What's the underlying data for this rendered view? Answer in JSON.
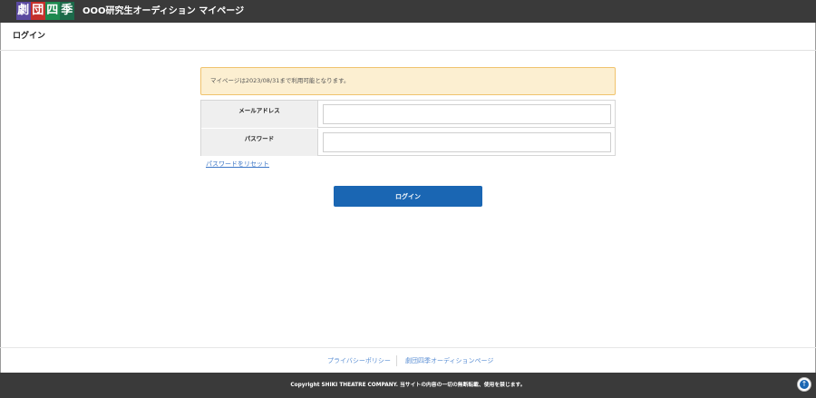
{
  "header": {
    "logo_chars": [
      "劇",
      "団",
      "四",
      "季"
    ],
    "site_title": "OOO研究生オーディション マイページ"
  },
  "page": {
    "title": "ログイン"
  },
  "notice": {
    "text": "マイページは2023/08/31まで利用可能となります。"
  },
  "form": {
    "email_label": "メールアドレス",
    "email_value": "",
    "password_label": "パスワード",
    "password_value": "",
    "reset_link": "パスワードをリセット",
    "submit_label": "ログイン"
  },
  "footer": {
    "links": [
      "プライバシーポリシー",
      "劇団四季オーディションページ"
    ],
    "copyright": "Copyright SHIKI THEATRE COMPANY. 当サイトの内容の一切の無断転載、使用を禁じます。"
  },
  "icons": {
    "page_top": "arrow-up-icon"
  },
  "colors": {
    "topbar": "#3a3a3a",
    "primary": "#1a66b3",
    "notice_bg": "#fcefd1",
    "notice_border": "#f0c36d",
    "link": "#3d77c7"
  }
}
